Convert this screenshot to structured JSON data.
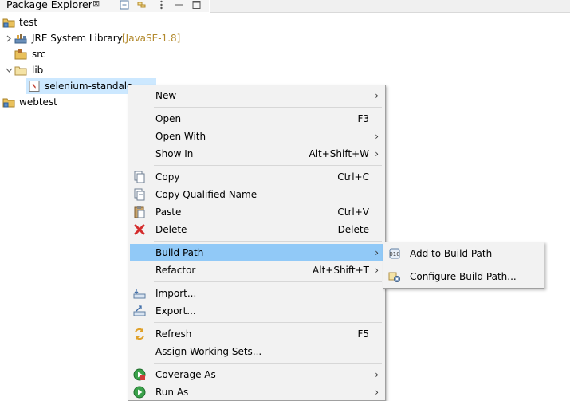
{
  "explorer": {
    "title": "Package Explorer",
    "close_glyph": "⊠",
    "tree": [
      {
        "label": "test",
        "icon": "project-icon",
        "expanded": true
      },
      {
        "label": "JRE System Library",
        "decoration": "[JavaSE-1.8]",
        "icon": "library-icon",
        "expanded": false
      },
      {
        "label": "src",
        "icon": "source-folder-icon"
      },
      {
        "label": "lib",
        "icon": "folder-icon",
        "expanded": true
      },
      {
        "label": "selenium-standalo",
        "icon": "jar-icon",
        "selected": true
      },
      {
        "label": "webtest",
        "icon": "project-icon"
      }
    ]
  },
  "context_menu": {
    "items": [
      {
        "label": "New",
        "accel": "",
        "submenu": true
      },
      {
        "label": "Open",
        "accel": "F3"
      },
      {
        "label": "Open With",
        "accel": "",
        "submenu": true
      },
      {
        "label": "Show In",
        "accel": "Alt+Shift+W",
        "submenu": true
      },
      {
        "label": "Copy",
        "accel": "Ctrl+C",
        "icon": "copy-icon"
      },
      {
        "label": "Copy Qualified Name",
        "accel": "",
        "icon": "copy-qualified-icon"
      },
      {
        "label": "Paste",
        "accel": "Ctrl+V",
        "icon": "paste-icon"
      },
      {
        "label": "Delete",
        "accel": "Delete",
        "icon": "delete-icon"
      },
      {
        "label": "Build Path",
        "accel": "",
        "submenu": true,
        "highlighted": true
      },
      {
        "label": "Refactor",
        "accel": "Alt+Shift+T",
        "submenu": true
      },
      {
        "label": "Import...",
        "accel": "",
        "icon": "import-icon"
      },
      {
        "label": "Export...",
        "accel": "",
        "icon": "export-icon"
      },
      {
        "label": "Refresh",
        "accel": "F5",
        "icon": "refresh-icon"
      },
      {
        "label": "Assign Working Sets...",
        "accel": ""
      },
      {
        "label": "Coverage As",
        "accel": "",
        "submenu": true,
        "icon": "coverage-icon"
      },
      {
        "label": "Run As",
        "accel": "",
        "submenu": true,
        "icon": "run-icon"
      }
    ],
    "submenu_arrow": "›"
  },
  "build_path_submenu": {
    "items": [
      {
        "label": "Add to Build Path",
        "icon": "add-to-build-path-icon"
      },
      {
        "label": "Configure Build Path...",
        "icon": "configure-build-path-icon"
      }
    ]
  },
  "colors": {
    "highlight": "#91c9f7",
    "menu_bg": "#f2f2f2",
    "selection": "#cce8ff",
    "decoration": "#b38a2e"
  }
}
